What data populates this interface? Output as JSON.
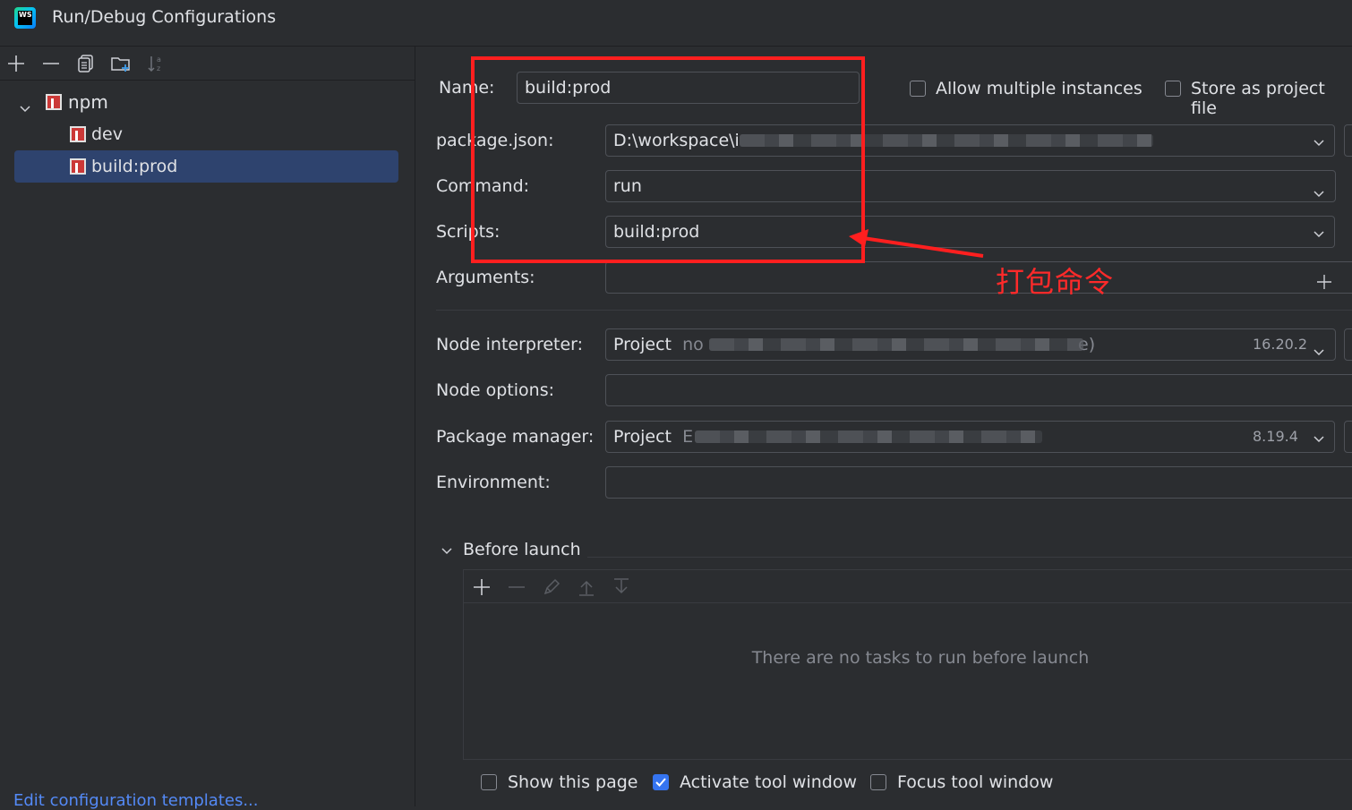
{
  "window": {
    "title": "Run/Debug Configurations"
  },
  "tree": {
    "group": {
      "label": "npm"
    },
    "items": [
      {
        "label": "dev"
      },
      {
        "label": "build:prod"
      }
    ]
  },
  "left_footer": {
    "link": "Edit configuration templates..."
  },
  "form": {
    "name_label": "Name:",
    "name_value": "build:prod",
    "allow_multiple_label": "Allow multiple instances",
    "store_project_label": "Store as project file",
    "package_json_label": "package.json:",
    "package_json_value": "D:\\workspace\\i",
    "command_label": "Command:",
    "command_value": "run",
    "scripts_label": "Scripts:",
    "scripts_value": "build:prod",
    "arguments_label": "Arguments:",
    "node_interpreter_label": "Node interpreter:",
    "node_interpreter_prefix": "Project",
    "node_interpreter_path_start": "no",
    "node_interpreter_path_end": "e)",
    "node_version": "16.20.2",
    "node_options_label": "Node options:",
    "package_manager_label": "Package manager:",
    "package_manager_prefix": "Project",
    "package_manager_path_start": "E",
    "package_manager_version": "8.19.4",
    "environment_label": "Environment:"
  },
  "before_launch": {
    "title": "Before launch",
    "empty_text": "There are no tasks to run before launch"
  },
  "bottom_options": {
    "show_page_label": "Show this page",
    "show_page_checked": false,
    "activate_tool_label": "Activate tool window",
    "activate_tool_checked": true,
    "focus_tool_label": "Focus tool window",
    "focus_tool_checked": false
  },
  "annotation": {
    "text": "打包命令",
    "color": "#ff1f1f"
  },
  "colors": {
    "background": "#2b2d30",
    "selection": "#2e436e",
    "accent": "#3574f0",
    "link": "#548af7"
  }
}
